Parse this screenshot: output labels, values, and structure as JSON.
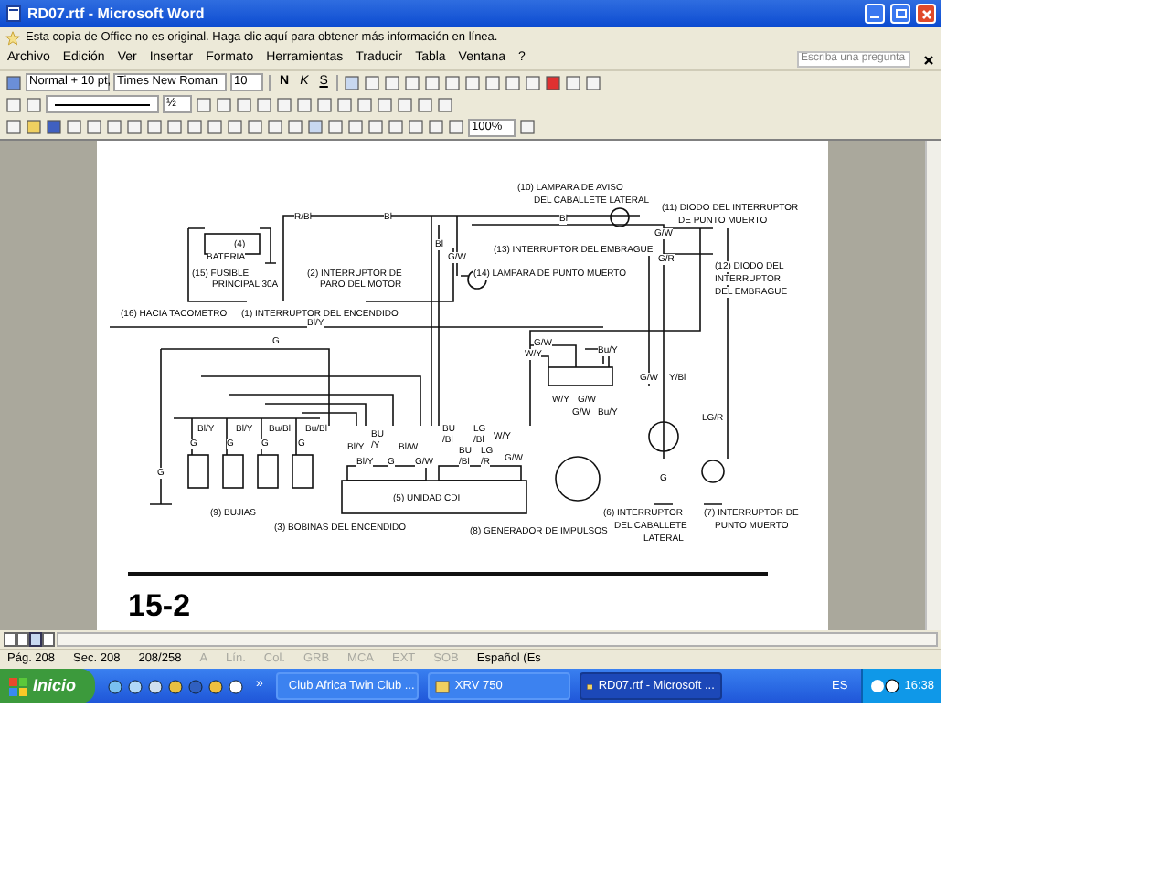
{
  "window": {
    "title": "RD07.rtf - Microsoft Word"
  },
  "notice": "Esta copia de Office no es original.  Haga clic aquí para obtener más información en línea.",
  "menu": [
    "Archivo",
    "Edición",
    "Ver",
    "Insertar",
    "Formato",
    "Herramientas",
    "Traducir",
    "Tabla",
    "Ventana",
    "?"
  ],
  "help_search": {
    "placeholder": "Escriba una pregunta"
  },
  "formatting_toolbar": {
    "style": "Normal + 10 pt,",
    "font": "Times New Roman",
    "size": "10",
    "bold": "N",
    "italic": "K",
    "underline": "S"
  },
  "drawing_toolbar": {
    "line_weight": "½"
  },
  "standard_toolbar": {
    "zoom": "100%"
  },
  "document": {
    "diagram_labels": [
      "R/Bl",
      "Bl",
      "(4)",
      "BATERIA",
      "(15) FUSIBLE",
      "PRINCIPAL 30A",
      "(2) INTERRUPTOR DE",
      "PARO DEL MOTOR",
      "(16) HACIA TACOMETRO",
      "(1) INTERRUPTOR DEL ENCENDIDO",
      "Bl/Y",
      "G",
      "Bl",
      "G/W",
      "(10) LAMPARA DE AVISO",
      "DEL CABALLETE LATERAL",
      "Bl",
      "(11) DIODO DEL INTERRUPTOR",
      "DE PUNTO MUERTO",
      "G/W",
      "(13) INTERRUPTOR DEL EMBRAGUE",
      "G/R",
      "(14) LAMPARA DE PUNTO MUERTO",
      "(12) DIODO DEL",
      "INTERRUPTOR",
      "DEL EMBRAGUE",
      "G/W",
      "W/Y",
      "Bu/Y",
      "W/Y",
      "G/W",
      "G/W",
      "Bu/Y",
      "G/W",
      "Y/Bl",
      "LG/R",
      "Bl/Y",
      "Bl/Y",
      "Bu/Bl",
      "Bu/Bl",
      "G",
      "G",
      "G",
      "G",
      "G",
      "Bl/Y",
      "Bl/Y",
      "BU",
      "/Y",
      "G",
      "Bl/W",
      "G/W",
      "BU",
      "/Bl",
      "BU",
      "/Bl",
      "LG",
      "/Bl",
      "LG",
      "/R",
      "W/Y",
      "G/W",
      "(9) BUJIAS",
      "(5) UNIDAD CDI",
      "(3) BOBINAS DEL ENCENDIDO",
      "(8) GENERADOR DE IMPULSOS",
      "(6) INTERRUPTOR",
      "DEL CABALLETE",
      "LATERAL",
      "(7) INTERRUPTOR DE",
      "PUNTO MUERTO",
      "G"
    ],
    "page_number": "15-2"
  },
  "status_bar": [
    {
      "text": "Pág. 208",
      "disabled": false
    },
    {
      "text": "Sec. 208",
      "disabled": false
    },
    {
      "text": "208/258",
      "disabled": false
    },
    {
      "text": "A",
      "disabled": true
    },
    {
      "text": "Lín.",
      "disabled": true
    },
    {
      "text": "Col.",
      "disabled": true
    },
    {
      "text": "GRB",
      "disabled": true
    },
    {
      "text": "MCA",
      "disabled": true
    },
    {
      "text": "EXT",
      "disabled": true
    },
    {
      "text": "SOB",
      "disabled": true
    },
    {
      "text": "Español (Es",
      "disabled": false
    }
  ],
  "taskbar": {
    "start": "Inicio",
    "chevron": "»",
    "tasks": [
      {
        "label": "Club Africa Twin Club ...",
        "selected": false
      },
      {
        "label": "XRV 750",
        "selected": false
      },
      {
        "label": "RD07.rtf - Microsoft ...",
        "selected": true
      }
    ],
    "language": "ES",
    "clock": "16:38"
  }
}
